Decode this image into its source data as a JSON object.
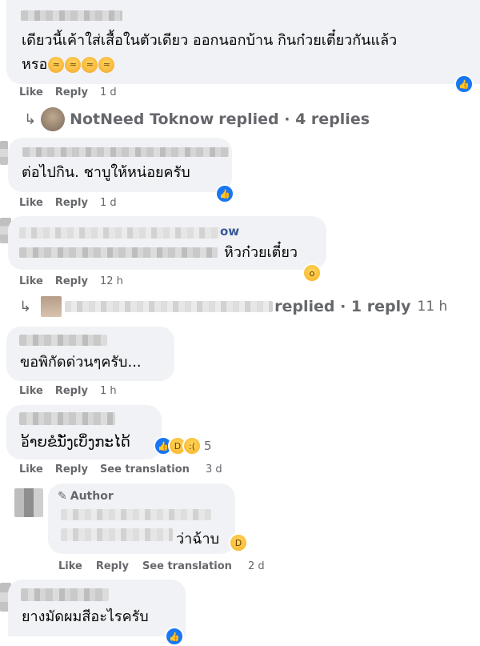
{
  "comments": [
    {
      "text_line1": "เดียวนี้เค้าใส่เสื้อในตัวเดียว ออกนอกบ้าน กินก๋วยเตี๋ยวกันแล้ว",
      "text_line2": "หรอ",
      "like": "Like",
      "reply": "Reply",
      "time": "1 d"
    },
    {
      "text": "ต่อไปกิน. ชาบูให้หน่อยครับ",
      "like": "Like",
      "reply": "Reply",
      "time": "1 d"
    },
    {
      "name_visible_suffix": "ow",
      "text": "หิวก๋วยเตี๋ยว",
      "like": "Like",
      "reply": "Reply",
      "time": "12 h"
    },
    {
      "text": "ขอพิกัดด่วนๆครับ...",
      "like": "Like",
      "reply": "Reply",
      "time": "1 h"
    },
    {
      "text": "อ້າຍຂໍນັ່ງເບິ່ງກະໄດ້",
      "reaction_count": "5",
      "like": "Like",
      "reply": "Reply",
      "see_translation": "See translation",
      "time": "3 d"
    },
    {
      "author_badge": "Author",
      "text": "ว่าฉ้าบ",
      "like": "Like",
      "reply": "Reply",
      "see_translation": "See translation",
      "time": "2 d"
    },
    {
      "text": "ยางมัดผมสีอะไรครับ"
    }
  ],
  "reply_threads": [
    {
      "name": "NotNeed Toknow",
      "suffix": "replied · 4 replies"
    },
    {
      "suffix": "replied · 1 reply",
      "time": "11 h"
    }
  ],
  "colors": {
    "bubble": "#f0f2f5",
    "secondary_text": "#65676b",
    "like_blue": "#1877f2",
    "emoji_yellow": "#f7b125"
  }
}
